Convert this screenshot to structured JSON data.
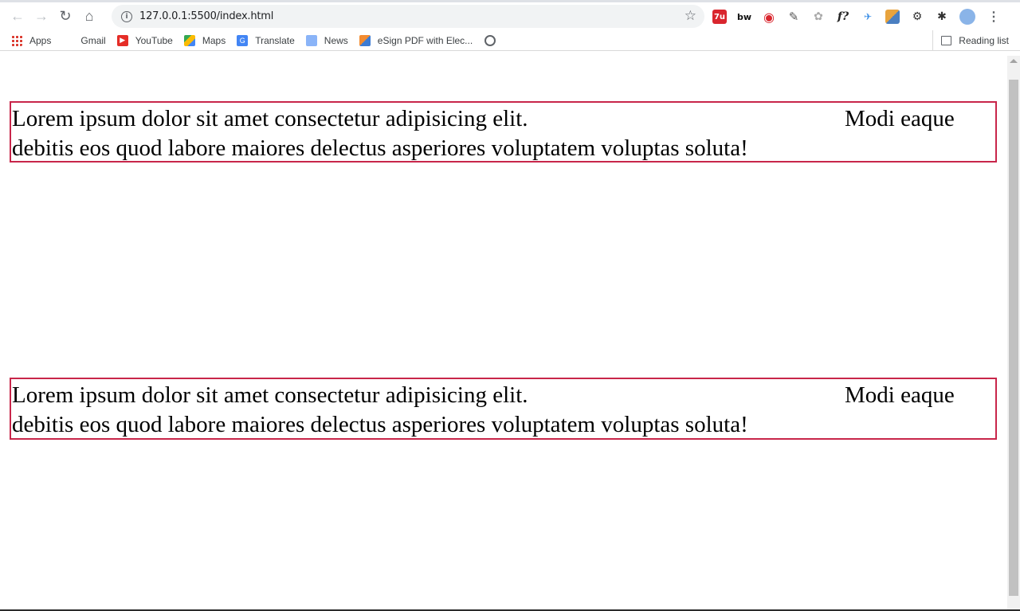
{
  "browser": {
    "url": "127.0.0.1:5500/index.html",
    "bookmarks": [
      {
        "label": "Apps",
        "icon": "apps-grid-icon"
      },
      {
        "label": "Gmail",
        "icon": "gmail-icon"
      },
      {
        "label": "YouTube",
        "icon": "youtube-icon"
      },
      {
        "label": "Maps",
        "icon": "maps-icon"
      },
      {
        "label": "Translate",
        "icon": "translate-icon"
      },
      {
        "label": "News",
        "icon": "news-icon"
      },
      {
        "label": "eSign PDF with Elec...",
        "icon": "esign-icon"
      }
    ],
    "reading_list": "Reading list",
    "extensions": [
      "7u",
      "bw",
      "◉",
      "✎",
      "✿",
      "f?",
      "✈",
      "",
      "⚙",
      "✱"
    ]
  },
  "page": {
    "boxes": [
      {
        "line1_left": "Lorem ipsum dolor sit amet consectetur adipisicing elit.",
        "line1_right": "Modi eaque",
        "line2": "debitis eos quod labore maiores delectus asperiores voluptatem voluptas soluta!"
      },
      {
        "line1_left": "Lorem ipsum dolor sit amet consectetur adipisicing elit.",
        "line1_right": "Modi eaque",
        "line2": "debitis eos quod labore maiores delectus asperiores voluptatem voluptas soluta!"
      }
    ]
  },
  "colors": {
    "box_border": "#c8264a"
  }
}
